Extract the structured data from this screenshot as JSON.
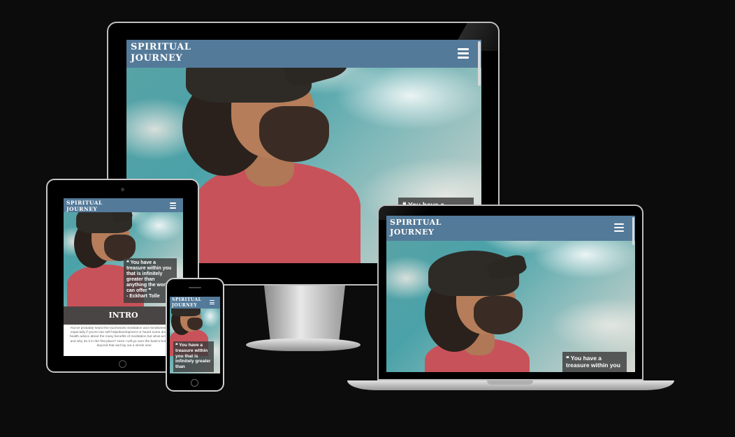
{
  "site": {
    "brand_line1": "SPIRITUAL",
    "brand_line2": "JOURNEY",
    "menu_icon": "hamburger-icon"
  },
  "quote": {
    "full": "❝ You have a treasure within you that is infinitely greater than anything the world can offer ❞",
    "author": "- Eckhart Tolle",
    "desktop_partial": "❝ You have a",
    "laptop_line1": "❝ You have a",
    "laptop_line2": "treasure within you",
    "phone": "❝ You have a treasure within you that is infinitely greater than"
  },
  "intro": {
    "heading": "INTRO",
    "body": "You've probably heard the buzzwords meditation and mindfulness before especially if you're into self help/development or heard some doctor give health advice about the many benefits of meditation but what actually is it and why do it in the first place? Here I will go over the basics but I will go beyond that and lay out a whole new"
  },
  "colors": {
    "navbar": "#547a99",
    "background": "#0d0c0d",
    "quote_bg": "#3c3c3c",
    "intro_bg": "#4a4545"
  }
}
